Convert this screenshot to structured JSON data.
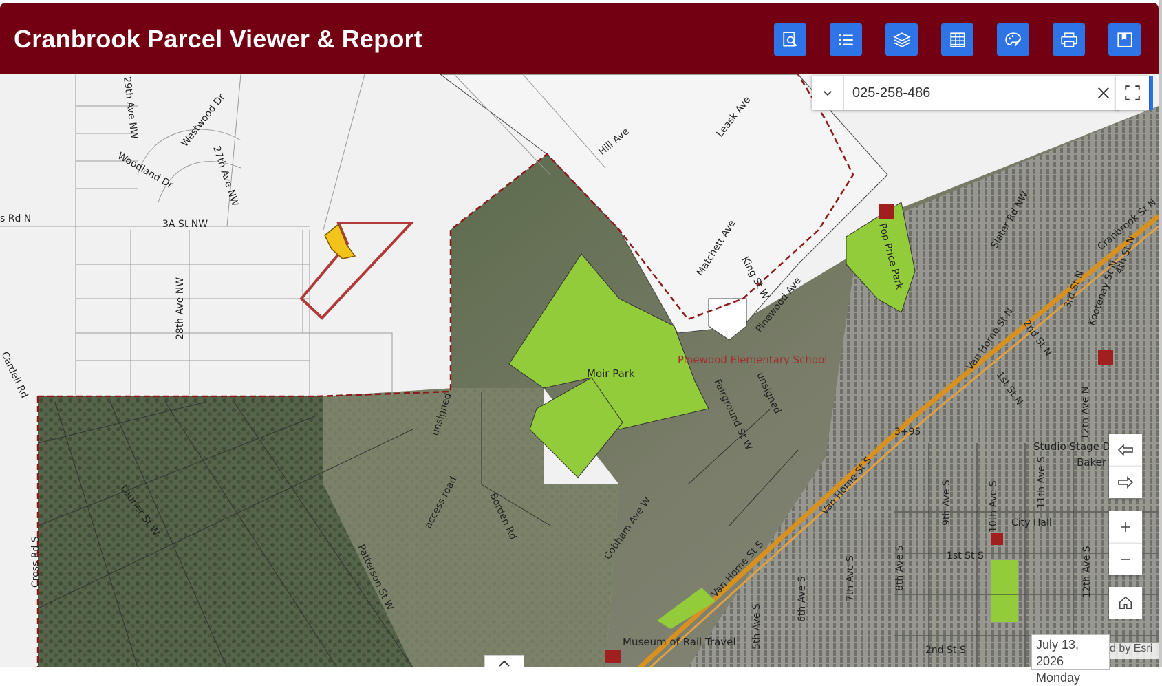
{
  "app": {
    "title": "Cranbrook Parcel Viewer & Report"
  },
  "toolbar": {
    "buttons": [
      {
        "name": "search-report",
        "icon": "report-search-icon"
      },
      {
        "name": "legend",
        "icon": "list-icon"
      },
      {
        "name": "layers",
        "icon": "layers-icon"
      },
      {
        "name": "attribute-table",
        "icon": "table-icon"
      },
      {
        "name": "basemap-style",
        "icon": "palette-icon"
      },
      {
        "name": "print",
        "icon": "printer-icon"
      },
      {
        "name": "bookmark",
        "icon": "bookmark-icon"
      }
    ],
    "button_color": "#2e74e6"
  },
  "header_color": "#720012",
  "search": {
    "value": "025-258-486"
  },
  "map": {
    "street_labels": {
      "ave29": "29th Ave NW",
      "westwood": "Westwood Dr",
      "woodland": "Woodland Dr",
      "ave27": "27th Ave NW",
      "rdn": "s Rd N",
      "st3a": "3A St NW",
      "ave28": "28th Ave NW",
      "cardell": "Cardell Rd",
      "hill": "Hill Ave",
      "leask": "Leask Ave",
      "matchett": "Matchett Ave",
      "kingst": "King St W",
      "pinewood_ave": "Pinewood Ave",
      "fairground": "Fairground St W",
      "unsigned1": "unsigned",
      "unsigned2": "unsigned",
      "laurier": "Laurier St W",
      "access": "access road",
      "borden": "Borden Rd",
      "patterson": "Patterson St W",
      "cobham": "Cobham Ave W",
      "crossrd": "Cross Rd S",
      "slater": "Slater Rd NW",
      "vanhorne_n": "Van Horne St N",
      "vanhorne_s": "Van Horne St S",
      "vanhorne_s2": "Van Horne St S",
      "cranbrook_n": "Cranbrook St N",
      "kootenay": "Kootenay St N",
      "st4": "4th St N",
      "st3": "3rd St N",
      "st2": "2nd St N",
      "st1": "1st St N",
      "ave12n": "12th Ave N",
      "ave5": "5th Ave S",
      "ave6": "6th Ave S",
      "ave7": "7th Ave S",
      "ave8": "8th Ave S",
      "ave9": "9th Ave S",
      "ave10": "10th Ave S",
      "ave11": "11th Ave S",
      "ave12s": "12th Ave S",
      "st1s": "1st St S",
      "st2s": "2nd St S",
      "hwy": "3+95"
    },
    "place_labels": {
      "moir": "Moir Park",
      "pinewood_school": "Pinewood Elementary School",
      "poppnce": "Pop Price Park",
      "studio": "Studio Stage Do",
      "baker": "Baker S",
      "cityhall": "City Hall",
      "museum": "Museum of Rail Travel"
    }
  },
  "date": {
    "line1": "July 13, 2026",
    "line2": "Monday"
  },
  "attribution": "d by Esri"
}
